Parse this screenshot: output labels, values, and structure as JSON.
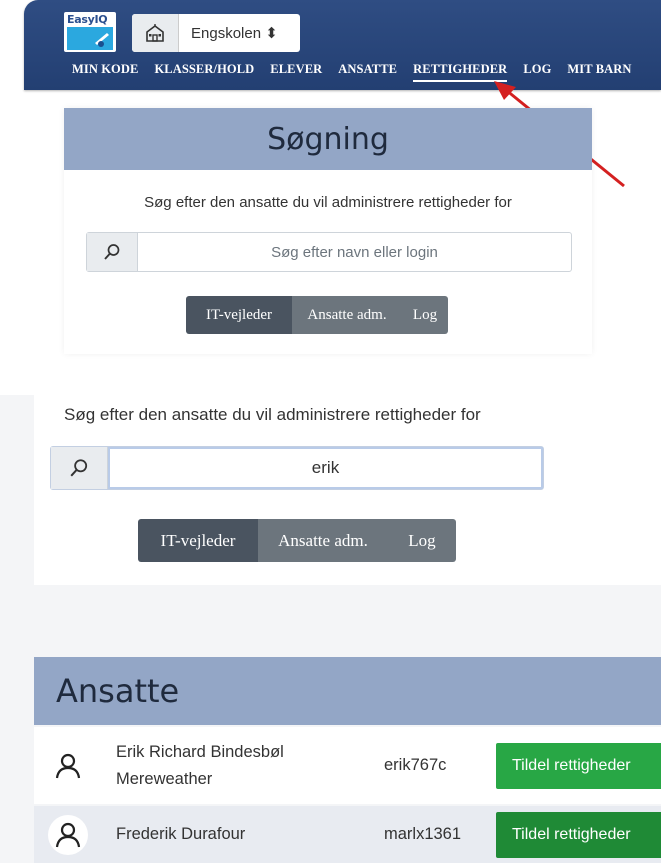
{
  "navbar": {
    "logo_text": "EasyIQ",
    "school": "Engskolen ⬍",
    "school_icon": "school-building-icon",
    "menu": [
      "MIN KODE",
      "KLASSER/HOLD",
      "ELEVER",
      "ANSATTE",
      "RETTIGHEDER",
      "LOG",
      "MIT BARN"
    ],
    "active_menu": "RETTIGHEDER"
  },
  "search_card": {
    "title": "Søgning",
    "hint": "Søg efter den ansatte du vil administrere rettigheder for",
    "placeholder": "Søg efter navn eller login",
    "tabs": [
      "IT-vejleder",
      "Ansatte adm.",
      "Log"
    ]
  },
  "search_card_2": {
    "hint": "Søg efter den ansatte du vil administrere rettigheder for",
    "value": "erik",
    "tabs": [
      "IT-vejleder",
      "Ansatte adm.",
      "Log"
    ]
  },
  "employees": {
    "title": "Ansatte",
    "rows": [
      {
        "name_line1": "Erik Richard Bindesbøl",
        "name_line2": "Mereweather",
        "login": "erik767c",
        "action": "Tildel rettigheder"
      },
      {
        "name_line1": "Frederik Durafour",
        "name_line2": "",
        "login": "marlx1361",
        "action": "Tildel rettigheder"
      }
    ]
  },
  "colors": {
    "navbar": "#2f4d83",
    "card_header": "#93a6c6",
    "grant_button": "#28a745",
    "annotation_arrow": "#d42020"
  }
}
